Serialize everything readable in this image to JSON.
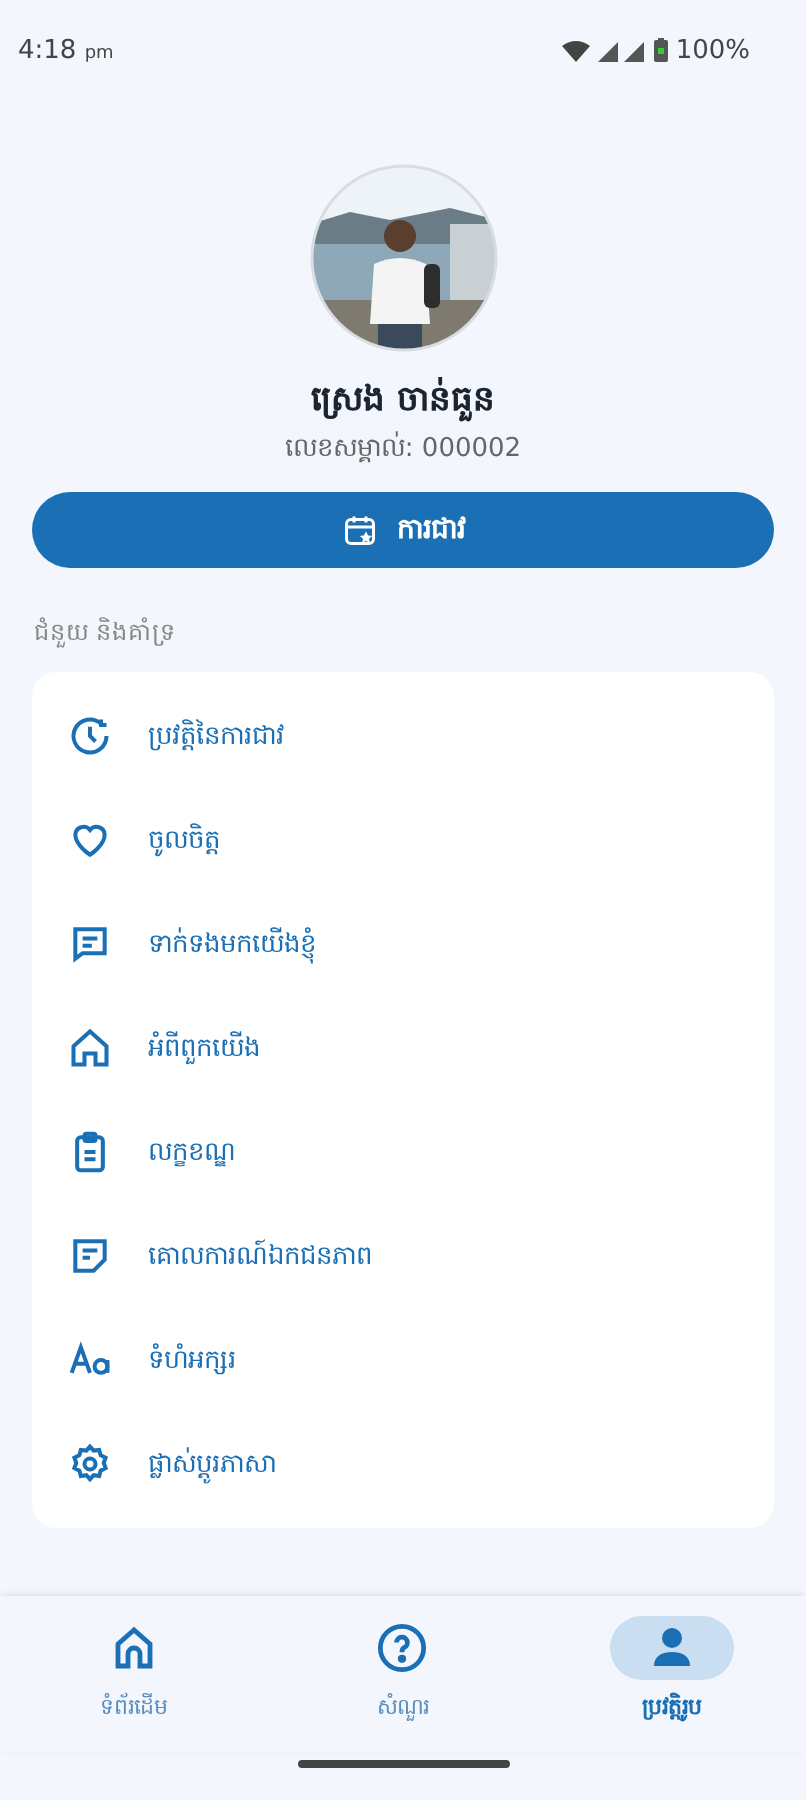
{
  "status_bar": {
    "time": "4:18",
    "ampm": "pm",
    "battery": "100%"
  },
  "profile": {
    "kind": "picture",
    "name": "ស្រេង ចាន់ធួន",
    "id_label": "លេខសម្គាល់: 000002"
  },
  "subscribe_button": {
    "label": "ការជាវ"
  },
  "section": {
    "title": "ជំនួយ និងគាំទ្រ",
    "items": [
      {
        "label": "ប្រវត្តិនៃការជាវ"
      },
      {
        "label": "ចូលចិត្ត"
      },
      {
        "label": "ទាក់ទងមកយើងខ្ញុំ"
      },
      {
        "label": "អំពីពួកយើង"
      },
      {
        "label": "លក្ខខណ្ឌ"
      },
      {
        "label": "គោលការណ៍ឯកជនភាព"
      },
      {
        "label": "ទំហំអក្សរ"
      },
      {
        "label": "ផ្លាស់ប្តូរភាសា"
      }
    ]
  },
  "bottom_nav": [
    {
      "label": "ទំព័រដើម",
      "selected": false
    },
    {
      "label": "សំណួរ",
      "selected": false
    },
    {
      "label": "ប្រវត្តិរូប",
      "selected": true
    }
  ]
}
